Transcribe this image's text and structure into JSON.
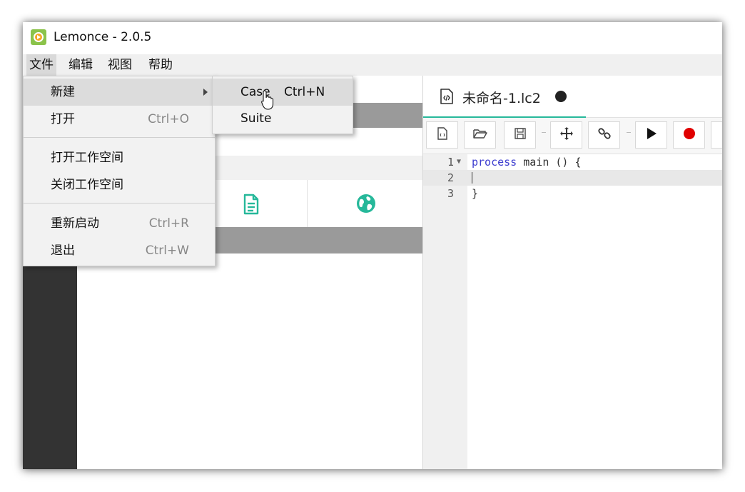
{
  "app": {
    "title": "Lemonce - 2.0.5",
    "icon": "lemonce-app-icon"
  },
  "menubar": {
    "items": [
      {
        "label": "文件"
      },
      {
        "label": "编辑"
      },
      {
        "label": "视图"
      },
      {
        "label": "帮助"
      }
    ]
  },
  "file_menu": {
    "items": [
      {
        "label": "新建",
        "shortcut": "",
        "submenu": true
      },
      {
        "label": "打开",
        "shortcut": "Ctrl+O"
      },
      {
        "label": "打开工作空间",
        "shortcut": ""
      },
      {
        "label": "关闭工作空间",
        "shortcut": ""
      },
      {
        "label": "重新启动",
        "shortcut": "Ctrl+R"
      },
      {
        "label": "退出",
        "shortcut": "Ctrl+W"
      }
    ]
  },
  "new_submenu": {
    "items": [
      {
        "label": "Case",
        "shortcut": "Ctrl+N"
      },
      {
        "label": "Suite",
        "shortcut": ""
      }
    ]
  },
  "sidebar": {
    "icons": [
      "document-icon",
      "globe-icon"
    ]
  },
  "editor": {
    "tab": {
      "label": "未命名-1.lc2",
      "modified": true
    },
    "toolbar": [
      "new-file-icon",
      "open-folder-icon",
      "save-icon",
      "move-icon",
      "link-icon",
      "play-icon",
      "record-icon"
    ],
    "lines": [
      {
        "number": "1",
        "keyword": "process",
        "rest": " main () {"
      },
      {
        "number": "2",
        "keyword": "",
        "rest": ""
      },
      {
        "number": "3",
        "keyword": "",
        "rest": "}"
      }
    ]
  },
  "colors": {
    "accent": "#26b89a",
    "record": "#e00000",
    "keyword": "#3d3dcf"
  }
}
